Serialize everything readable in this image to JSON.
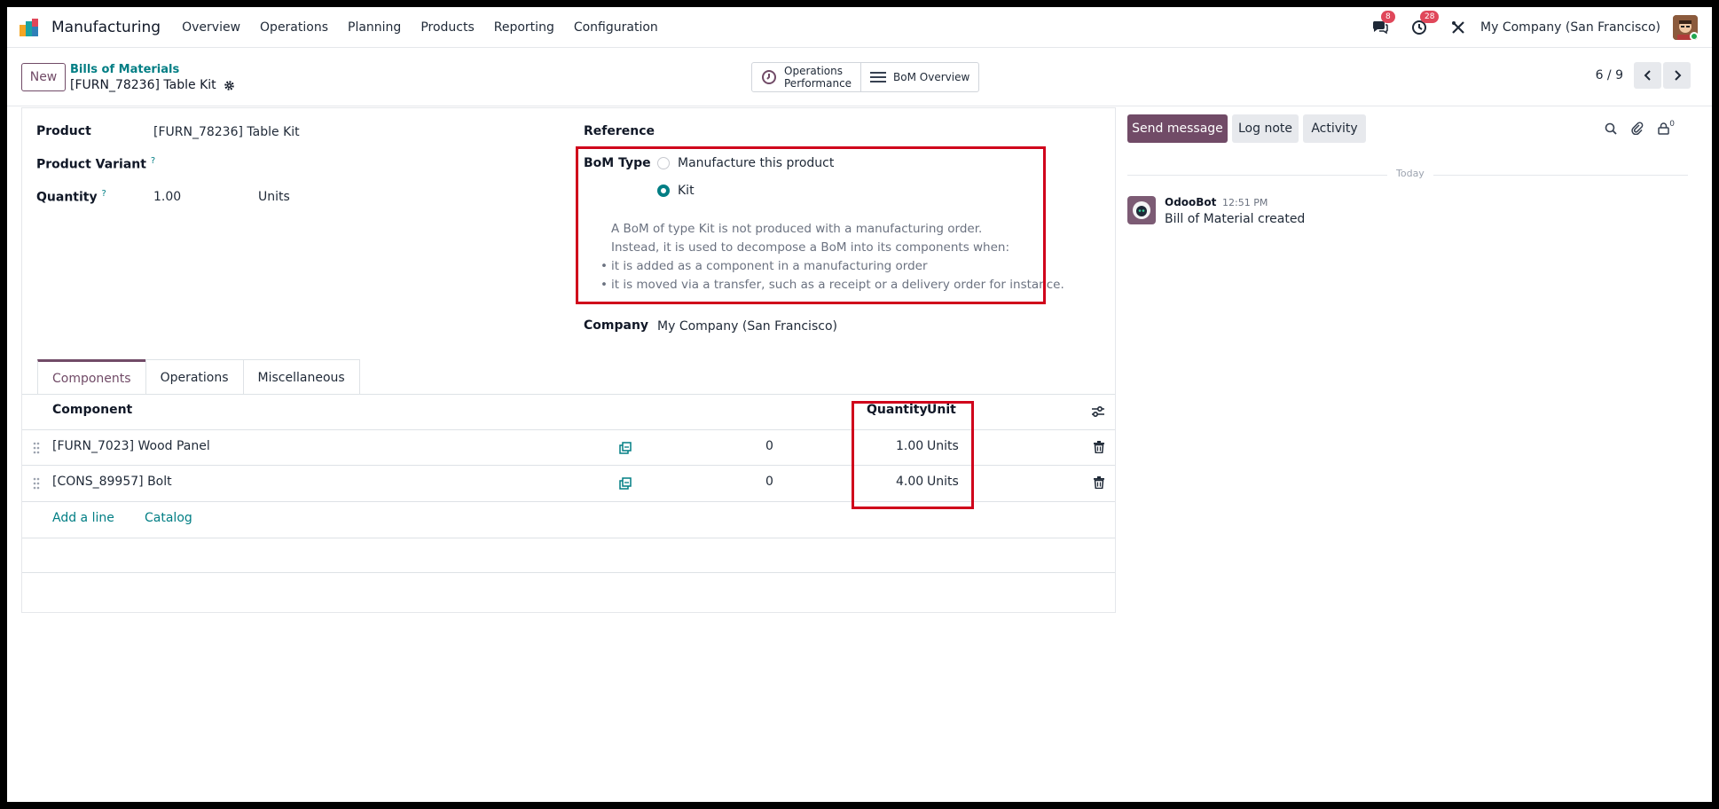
{
  "navbar": {
    "app_name": "Manufacturing",
    "menu": [
      "Overview",
      "Operations",
      "Planning",
      "Products",
      "Reporting",
      "Configuration"
    ],
    "messages_count": "8",
    "activities_count": "28",
    "company": "My Company (San Francisco)"
  },
  "control": {
    "new_label": "New",
    "breadcrumb_parent": "Bills of Materials",
    "breadcrumb_current": "[FURN_78236] Table Kit",
    "smart_buttons": {
      "ops_perf_line1": "Operations",
      "ops_perf_line2": "Performance",
      "bom_overview": "BoM Overview"
    },
    "pager": "6 / 9"
  },
  "form": {
    "product_label": "Product",
    "product_value": "[FURN_78236] Table Kit",
    "variant_label": "Product Variant",
    "quantity_label": "Quantity",
    "quantity_value": "1.00",
    "quantity_unit": "Units",
    "help_mark": "?",
    "reference_label": "Reference",
    "bom_type_label": "BoM Type",
    "bom_type_options": [
      "Manufacture this product",
      "Kit"
    ],
    "bom_type_selected": "Kit",
    "help_text_1": "A BoM of type Kit is not produced with a manufacturing order.",
    "help_text_2": "Instead, it is used to decompose a BoM into its components when:",
    "help_bullets": [
      "it is added as a component in a manufacturing order",
      "it is moved via a transfer, such as a receipt or a delivery order for instance."
    ],
    "company_label": "Company",
    "company_value": "My Company (San Francisco)"
  },
  "tabs": [
    "Components",
    "Operations",
    "Miscellaneous"
  ],
  "components_table": {
    "headers": {
      "component": "Component",
      "quantity": "Quantity",
      "unit": "Unit"
    },
    "rows": [
      {
        "component": "[FURN_7023] Wood Panel",
        "extra": "0",
        "quantity": "1.00",
        "unit": "Units"
      },
      {
        "component": "[CONS_89957] Bolt",
        "extra": "0",
        "quantity": "4.00",
        "unit": "Units"
      }
    ],
    "add_line": "Add a line",
    "catalog": "Catalog"
  },
  "chatter": {
    "send_message": "Send message",
    "log_note": "Log note",
    "activity": "Activity",
    "followers_count": "0",
    "date_divider": "Today",
    "message": {
      "author": "OdooBot",
      "time": "12:51 PM",
      "body": "Bill of Material created"
    }
  },
  "colors": {
    "brand": "#714b67",
    "link": "#017e84",
    "highlight": "#d0021b",
    "badge": "#e0475a"
  }
}
